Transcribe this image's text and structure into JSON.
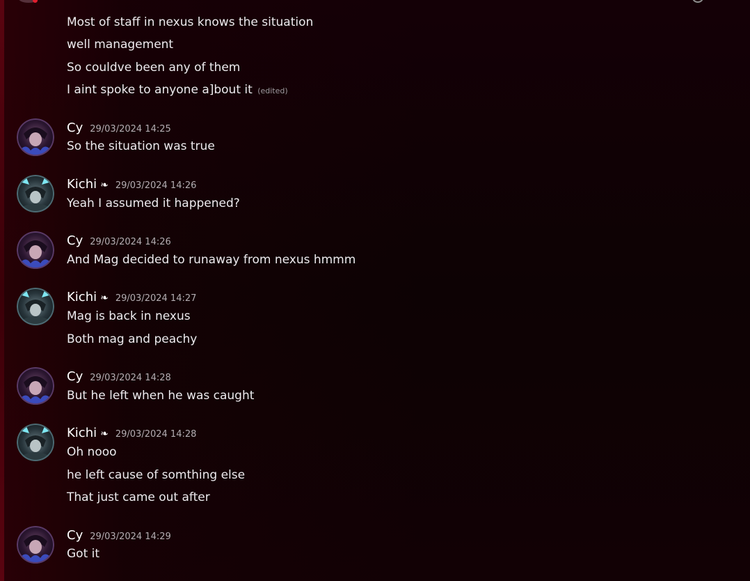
{
  "continuation": {
    "lines": [
      "Most of staff in nexus knows the situation",
      "well management",
      "So couldve been any of them",
      "I aint spoke to anyone a]bout it"
    ],
    "edited_label": "(edited)"
  },
  "messages": [
    {
      "author": "Cy",
      "timestamp": "29/03/2024 14:25",
      "avatar": "cy-avatar",
      "lines": [
        "So the situation was true"
      ]
    },
    {
      "author": "Kichi",
      "author_icon": "❧",
      "timestamp": "29/03/2024 14:26",
      "avatar": "kichi-avatar",
      "lines": [
        "Yeah I assumed it happened?"
      ]
    },
    {
      "author": "Cy",
      "timestamp": "29/03/2024 14:26",
      "avatar": "cy-avatar",
      "lines": [
        "And Mag decided to runaway from nexus hmmm"
      ]
    },
    {
      "author": "Kichi",
      "author_icon": "❧",
      "timestamp": "29/03/2024 14:27",
      "avatar": "kichi-avatar",
      "lines": [
        "Mag is back in nexus",
        "Both mag and peachy"
      ]
    },
    {
      "author": "Cy",
      "timestamp": "29/03/2024 14:28",
      "avatar": "cy-avatar",
      "lines": [
        "But he left when he was caught"
      ]
    },
    {
      "author": "Kichi",
      "author_icon": "❧",
      "timestamp": "29/03/2024 14:28",
      "avatar": "kichi-avatar",
      "lines": [
        "Oh nooo",
        "he left cause of somthing else",
        "That just came out after"
      ]
    },
    {
      "author": "Cy",
      "timestamp": "29/03/2024 14:29",
      "avatar": "cy-avatar",
      "lines": [
        "Got it"
      ]
    }
  ],
  "colors": {
    "background": "#0d0204",
    "edge_tint": "#5a0410",
    "text": "#ecebee",
    "timestamp": "#b3aeb2",
    "unread_dot": "#e01e2e"
  }
}
